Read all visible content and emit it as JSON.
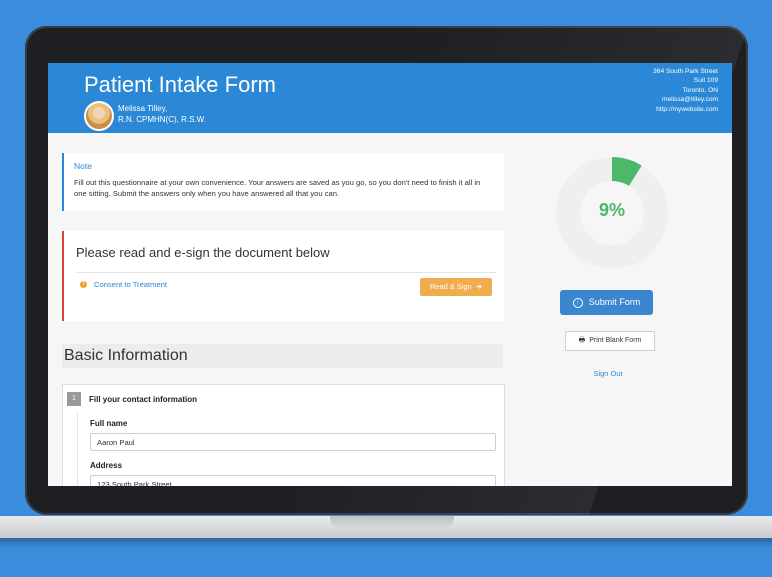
{
  "header": {
    "title": "Patient Intake Form",
    "author_name": "Melissa Tilley,",
    "author_credentials": "R.N. CPMHN(C), R.S.W.",
    "address": [
      "364 South Park Street",
      "Suit 109",
      "Toronto, ON",
      "melissa@tilley.com",
      "http://mywebsite.com"
    ]
  },
  "note": {
    "title": "Note",
    "text": "Fill out this questionnaire at your own convenience. Your answers are saved as you go, so you don't need to finish it all in one sitting. Submit the answers only when you have answered all that you can."
  },
  "sign": {
    "title": "Please read and e-sign the document below",
    "document": "Consent to Treatment",
    "button": "Read & Sign"
  },
  "basic": {
    "title": "Basic Information",
    "step_number": "1",
    "step_title": "Fill your contact information",
    "fields": [
      {
        "label": "Full name",
        "value": "Aaron Paul"
      },
      {
        "label": "Address",
        "value": "123 South Park Street"
      }
    ]
  },
  "progress": {
    "value": 0.09,
    "label": "9%"
  },
  "actions": {
    "submit": "Submit Form",
    "print": "Print Blank Form",
    "signout": "Sign Out"
  },
  "colors": {
    "brand": "#2a88d6",
    "progress": "#4cb86a",
    "warning": "#f0ad4e",
    "alert": "#d9443a"
  }
}
